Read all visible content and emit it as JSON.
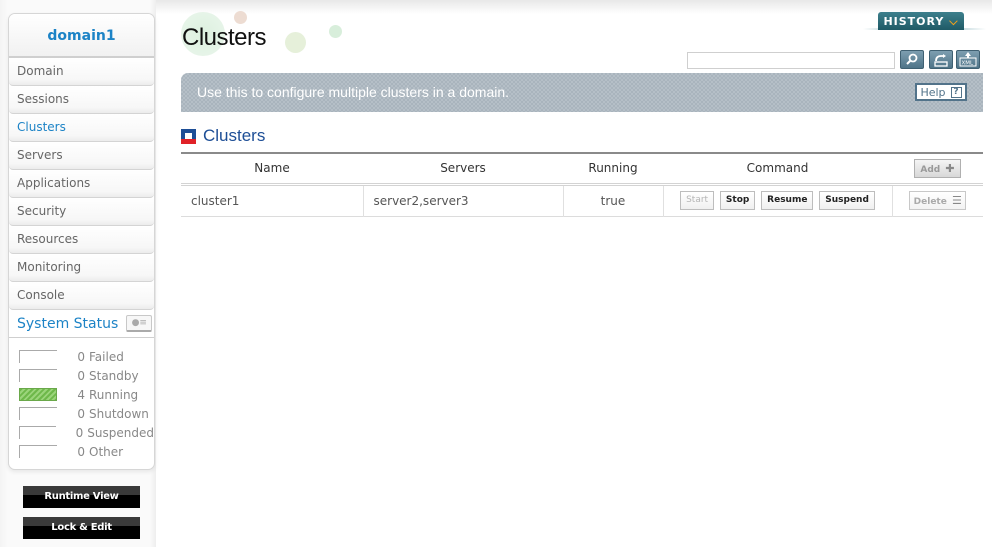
{
  "domain": {
    "name": "domain1"
  },
  "sidebar": {
    "items": [
      {
        "label": "Domain",
        "active": false
      },
      {
        "label": "Sessions",
        "active": false
      },
      {
        "label": "Clusters",
        "active": true
      },
      {
        "label": "Servers",
        "active": false
      },
      {
        "label": "Applications",
        "active": false
      },
      {
        "label": "Security",
        "active": false
      },
      {
        "label": "Resources",
        "active": false
      },
      {
        "label": "Monitoring",
        "active": false
      },
      {
        "label": "Console",
        "active": false
      }
    ],
    "system_status": {
      "title": "System Status",
      "toggle_icon": "chart-list-icon",
      "rows": [
        {
          "count": "0",
          "label": "Failed"
        },
        {
          "count": "0",
          "label": "Standby"
        },
        {
          "count": "4",
          "label": "Running"
        },
        {
          "count": "0",
          "label": "Shutdown"
        },
        {
          "count": "0",
          "label": "Suspended"
        },
        {
          "count": "0",
          "label": "Other"
        }
      ]
    },
    "runtime_view_label": "Runtime View",
    "lock_edit_label": "Lock & Edit"
  },
  "header": {
    "page_title": "Clusters",
    "history_label": "HISTORY",
    "history_chevron": "⌄",
    "search": {
      "value": "",
      "placeholder": ""
    },
    "tools": [
      {
        "name": "search-button",
        "glyph": "🔍"
      },
      {
        "name": "refresh-button",
        "glyph": "⟲"
      },
      {
        "name": "xml-export-button",
        "glyph": "XML"
      }
    ]
  },
  "banner": {
    "text": "Use this to configure multiple clusters in a domain.",
    "help_label": "Help",
    "help_glyph": "?"
  },
  "section": {
    "title": "Clusters"
  },
  "table": {
    "columns": [
      "Name",
      "Servers",
      "Running",
      "Command"
    ],
    "add_label": "Add",
    "add_glyph": "✚",
    "rows": [
      {
        "name": "cluster1",
        "servers": "server2,server3",
        "running": "true",
        "commands": [
          {
            "label": "Start",
            "enabled": false
          },
          {
            "label": "Stop",
            "enabled": true
          },
          {
            "label": "Resume",
            "enabled": true
          },
          {
            "label": "Suspend",
            "enabled": true
          }
        ],
        "delete_label": "Delete",
        "delete_glyph": "☰"
      }
    ]
  },
  "colors": {
    "accent_blue": "#1c83c6",
    "history_teal": "#2b6b78",
    "history_chevron": "#f3a21a",
    "running_green": "#6eb84a",
    "section_blue": "#1d4e96",
    "section_red": "#e02127"
  }
}
